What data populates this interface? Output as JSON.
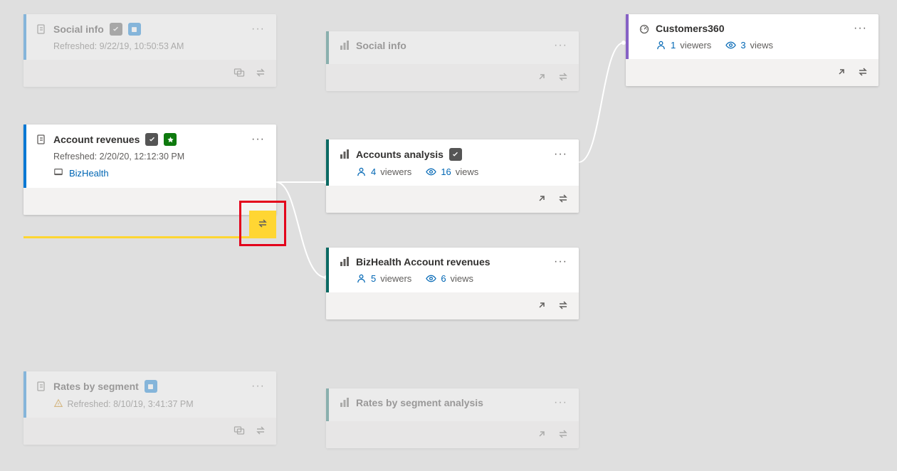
{
  "cards": {
    "social_ds": {
      "title": "Social info",
      "refreshed": "Refreshed: 9/22/19, 10:50:53 AM"
    },
    "account_ds": {
      "title": "Account revenues",
      "refreshed": "Refreshed: 2/20/20, 12:12:30 PM",
      "workspace": "BizHealth"
    },
    "rates_ds": {
      "title": "Rates by segment",
      "refreshed": "Refreshed: 8/10/19, 3:41:37 PM"
    },
    "social_rep": {
      "title": "Social info"
    },
    "accounts_rep": {
      "title": "Accounts analysis",
      "viewers_n": "4",
      "viewers_lbl": "viewers",
      "views_n": "16",
      "views_lbl": "views"
    },
    "biz_rep": {
      "title": "BizHealth Account revenues",
      "viewers_n": "5",
      "viewers_lbl": "viewers",
      "views_n": "6",
      "views_lbl": "views"
    },
    "rates_rep": {
      "title": "Rates by segment analysis"
    },
    "customers": {
      "title": "Customers360",
      "viewers_n": "1",
      "viewers_lbl": "viewers",
      "views_n": "3",
      "views_lbl": "views"
    }
  }
}
